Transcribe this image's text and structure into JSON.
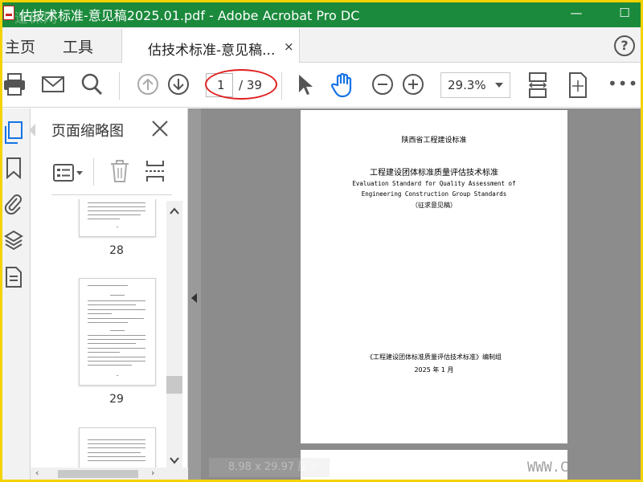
{
  "window": {
    "title": "估技术标准-意见稿2025.01.pdf - Adobe Acrobat Pro DC",
    "watermark": "速保网",
    "minimize_glyph": "—",
    "maximize_glyph": "☐"
  },
  "nav": {
    "home_label": "主页",
    "tools_label": "工具",
    "doc_tab_label": "估技术标准-意见稿...",
    "doc_tab_close": "×",
    "help_label": "?"
  },
  "toolbar": {
    "page_current": "1",
    "page_total": "/ 39",
    "zoom_value": "29.3%",
    "more_label": "•••"
  },
  "sidebar_rail": {
    "items": [
      "page-thumbnails-icon",
      "bookmark-icon",
      "attachment-icon",
      "layers-icon",
      "document-properties-icon"
    ]
  },
  "thumbnail_panel": {
    "title": "页面缩略图",
    "thumbnails": [
      {
        "page": "28"
      },
      {
        "page": "29"
      }
    ]
  },
  "document": {
    "org": "陕西省工程建设标准",
    "title_cn": "工程建设团体标准质量评估技术标准",
    "title_en_1": "Evaluation Standard for Quality Assessment of",
    "title_en_2": "Engineering Construction Group Standards",
    "draft_note": "（征求意见稿）",
    "compiler": "《工程建设团体标准质量评估技术标准》编制组",
    "date": "2025 年 1 月"
  },
  "status": {
    "page_size": "8.98 x 29.97 厘米",
    "site_watermark": "WWW.C"
  },
  "colors": {
    "titlebar": "#1b8a3c",
    "accent": "#1473e6",
    "highlight_oval": "#e02020",
    "frame": "#f5d300"
  }
}
